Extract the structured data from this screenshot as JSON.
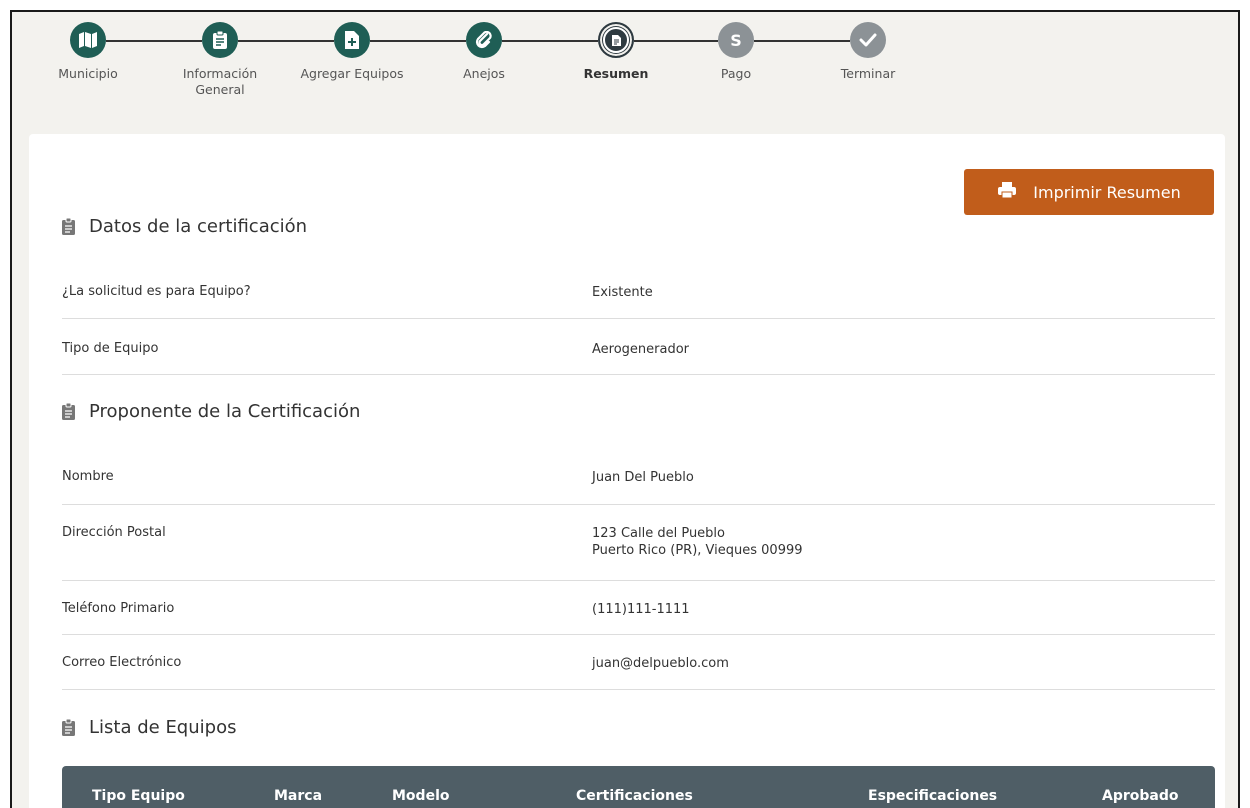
{
  "stepper": {
    "steps": [
      {
        "label": "Municipio",
        "icon": "map-icon",
        "state": "done"
      },
      {
        "label": "Información\nGeneral",
        "icon": "clipboard-icon",
        "state": "done"
      },
      {
        "label": "Agregar Equipos",
        "icon": "add-document-icon",
        "state": "done"
      },
      {
        "label": "Anejos",
        "icon": "paperclip-icon",
        "state": "done"
      },
      {
        "label": "Resumen",
        "icon": "document-icon",
        "state": "current"
      },
      {
        "label": "Pago",
        "icon": "dollar-icon",
        "state": "pending",
        "glyph": "S"
      },
      {
        "label": "Terminar",
        "icon": "check-icon",
        "state": "pending"
      }
    ]
  },
  "print_button": {
    "label": "Imprimir Resumen",
    "icon": "printer-icon"
  },
  "sections": {
    "certificacion": {
      "title": "Datos de la certificación",
      "rows": [
        {
          "key": "¿La solicitud es para Equipo?",
          "value": "Existente"
        },
        {
          "key": "Tipo de Equipo",
          "value": "Aerogenerador"
        }
      ]
    },
    "proponente": {
      "title": "Proponente de la Certificación",
      "rows": [
        {
          "key": "Nombre",
          "value": "Juan Del Pueblo"
        },
        {
          "key": "Dirección Postal",
          "value": "123 Calle del Pueblo",
          "value2": "Puerto Rico (PR), Vieques 00999"
        },
        {
          "key": "Teléfono Primario",
          "value": "(111)111-1111"
        },
        {
          "key": "Correo Electrónico",
          "value": "juan@delpueblo.com"
        }
      ]
    },
    "equipos": {
      "title": "Lista de Equipos",
      "columns": [
        "Tipo Equipo",
        "Marca",
        "Modelo",
        "Certificaciones",
        "Especificaciones",
        "Aprobado"
      ]
    }
  },
  "colors": {
    "step_done": "#1f5e55",
    "step_current": "#2e3a40",
    "step_pending": "#8c9296",
    "accent_button": "#c15d1b",
    "table_header": "#4f5e66"
  }
}
